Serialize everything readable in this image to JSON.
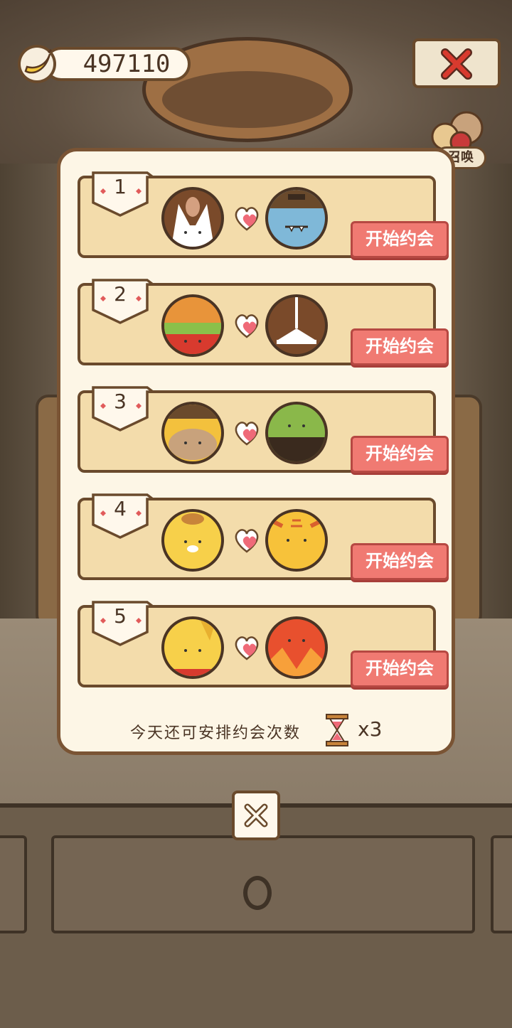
{
  "currency": {
    "value": "497110",
    "icon": "banana-icon"
  },
  "top_close": {
    "icon": "close-icon"
  },
  "summon": {
    "label": "召唤",
    "icon": "cat-group-icon"
  },
  "date_list": {
    "entries": [
      {
        "rank": "1",
        "pair": [
          "bunny-icon",
          "blue-monster-icon"
        ],
        "button_label": "开始约会"
      },
      {
        "rank": "2",
        "pair": [
          "burger-monster-icon",
          "lamp-monster-icon"
        ],
        "button_label": "开始约会"
      },
      {
        "rank": "3",
        "pair": [
          "lion-monster-icon",
          "green-monster-icon"
        ],
        "button_label": "开始约会"
      },
      {
        "rank": "4",
        "pair": [
          "yellow-dog-icon",
          "tiger-monster-icon"
        ],
        "button_label": "开始约会"
      },
      {
        "rank": "5",
        "pair": [
          "chick-monster-icon",
          "red-bird-monster-icon"
        ],
        "button_label": "开始约会"
      }
    ]
  },
  "quota": {
    "text": "今天还可安排约会次数",
    "count": "x3",
    "icon": "hourglass-icon"
  },
  "bottom_close": {
    "icon": "close-icon"
  },
  "colors": {
    "button": "#f07a72",
    "card": "#f3dcab",
    "panel": "#fdf6e6",
    "outline": "#6a4a2c"
  }
}
